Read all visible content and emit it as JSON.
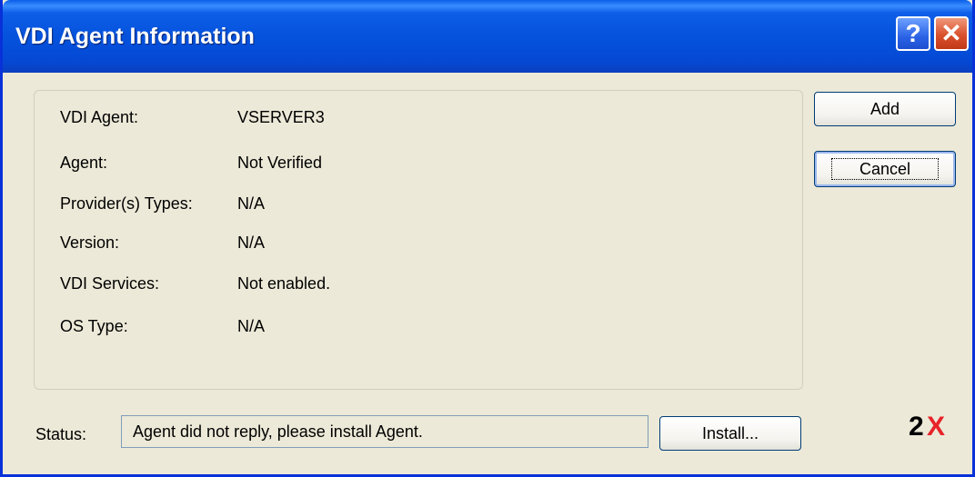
{
  "window": {
    "title": "VDI Agent Information"
  },
  "titlebar_buttons": {
    "help_label": "?",
    "close_label": "✕"
  },
  "info": {
    "rows": [
      {
        "label": "VDI Agent:",
        "value": "VSERVER3"
      },
      {
        "label": "Agent:",
        "value": "Not Verified"
      },
      {
        "label": "Provider(s) Types:",
        "value": "N/A"
      },
      {
        "label": "Version:",
        "value": "N/A"
      },
      {
        "label": "VDI Services:",
        "value": "Not enabled."
      },
      {
        "label": "OS Type:",
        "value": "N/A"
      }
    ]
  },
  "buttons": {
    "add": "Add",
    "cancel": "Cancel",
    "install": "Install..."
  },
  "status": {
    "label": "Status:",
    "value": "Agent did not reply, please install Agent."
  },
  "logo": {
    "text": "2X",
    "colors": {
      "two": "#000000",
      "x": "#e8232a"
    }
  },
  "colors": {
    "titlebar": "#0553dd",
    "dialog_bg": "#ece9d8",
    "border": "#0831d9"
  }
}
